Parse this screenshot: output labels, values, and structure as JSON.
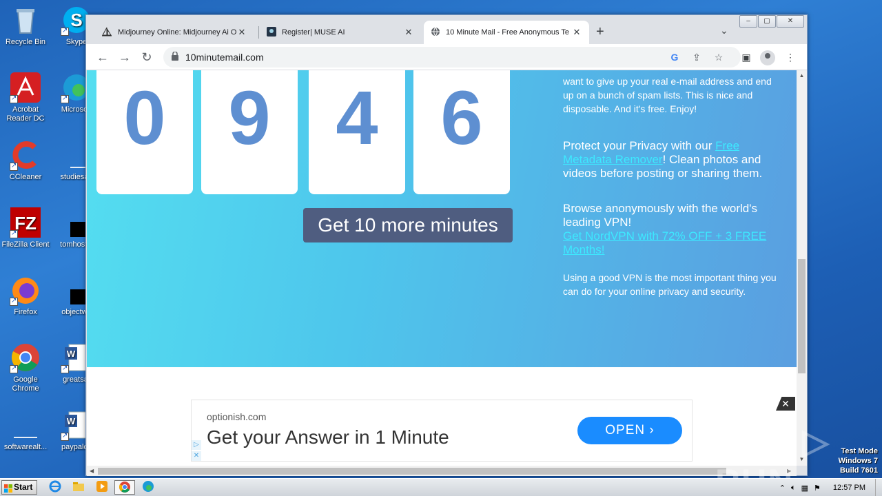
{
  "desktop": {
    "icons": [
      {
        "label": "Recycle Bin",
        "icon": "recycle-bin-icon"
      },
      {
        "label": "Skype",
        "icon": "skype-icon"
      },
      {
        "label": "Acrobat Reader DC",
        "icon": "acrobat-icon"
      },
      {
        "label": "Microsoft",
        "icon": "edge-icon"
      },
      {
        "label": "CCleaner",
        "icon": "ccleaner-icon"
      },
      {
        "label": "studiesag",
        "icon": "file-icon"
      },
      {
        "label": "FileZilla Client",
        "icon": "filezilla-icon"
      },
      {
        "label": "tomhostin",
        "icon": "file-icon"
      },
      {
        "label": "Firefox",
        "icon": "firefox-icon"
      },
      {
        "label": "objectwo",
        "icon": "file-icon"
      },
      {
        "label": "Google Chrome",
        "icon": "chrome-icon"
      },
      {
        "label": "greatsaf",
        "icon": "word-doc-icon"
      },
      {
        "label": "softwarealt...",
        "icon": "file-icon"
      },
      {
        "label": "paypalca",
        "icon": "word-doc-icon"
      }
    ]
  },
  "browser": {
    "tabs": [
      {
        "title": "Midjourney Online: Midjourney Ai On",
        "active": false
      },
      {
        "title": "Register| MUSE AI",
        "active": false
      },
      {
        "title": "10 Minute Mail - Free Anonymous Te",
        "active": true
      }
    ],
    "close_glyph": "✕",
    "new_tab_glyph": "+",
    "url": "10minutemail.com"
  },
  "page": {
    "digits": [
      "0",
      "9",
      "4",
      "6"
    ],
    "more_button": "Get 10 more minutes",
    "intro_text_tail": "want to give up your real e-mail address and end up on a bunch of spam lists. This is nice and disposable. And it's free. Enjoy!",
    "privacy_pre": "Protect your Privacy with our ",
    "privacy_link": "Free Metadata Remover",
    "privacy_post": "! Clean photos and videos before posting or sharing them.",
    "vpn_text": "Browse anonymously with the world's leading VPN!",
    "vpn_link": "Get NordVPN with 72% OFF + 3 FREE Months!",
    "vpn_note": "Using a good VPN is the most important thing you can do for your online privacy and security."
  },
  "ad": {
    "domain": "optionish.com",
    "headline": "Get your Answer in 1 Minute",
    "cta": "OPEN ›",
    "close": "✕"
  },
  "watermark": {
    "brand": "ANY ▷ RUN",
    "line1": "Test Mode",
    "line2": "Windows 7",
    "line3": "Build 7601"
  },
  "taskbar": {
    "start": "Start",
    "clock": "12:57 PM"
  },
  "colors": {
    "digit": "#5e8fd1",
    "hero_start": "#54def0",
    "hero_end": "#5a9ee0",
    "link": "#3de9ff",
    "button": "#4f5d80",
    "ad_cta": "#1a8cff"
  }
}
